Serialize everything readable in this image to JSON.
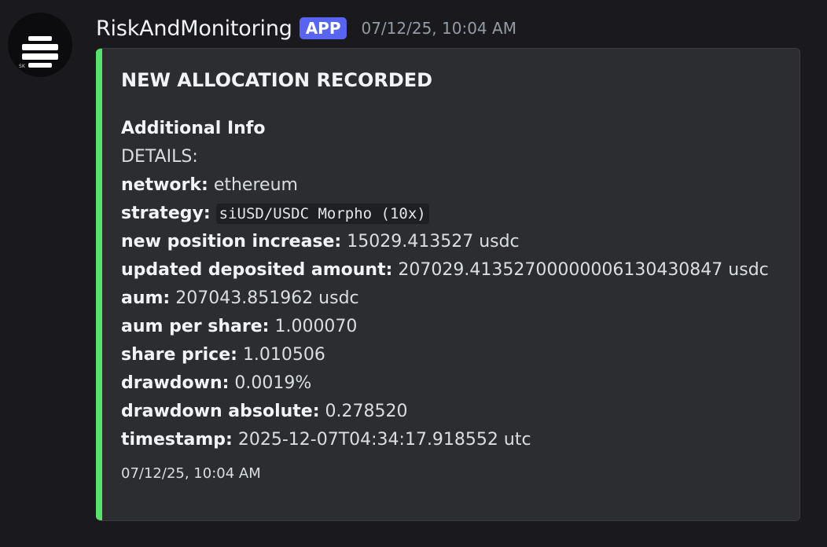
{
  "message": {
    "avatar_icon": "striped-globe-logo",
    "avatar_text": "SK",
    "username": "RiskAndMonitoring",
    "badge": "APP",
    "timestamp": "07/12/25, 10:04 AM"
  },
  "embed": {
    "accent_color": "#57e36a",
    "title": "NEW ALLOCATION RECORDED",
    "field_name": "Additional Info",
    "details_label": "DETAILS:",
    "lines": [
      {
        "key": "network:",
        "value": "ethereum"
      },
      {
        "key": "strategy:",
        "value": "siUSD/USDC Morpho (10x)"
      },
      {
        "key": "new position increase:",
        "value": "15029.413527 usdc"
      },
      {
        "key": "updated deposited amount:",
        "value": "207029.41352700000006130430847 usdc"
      },
      {
        "key": "aum:",
        "value": "207043.851962 usdc"
      },
      {
        "key": "aum per share:",
        "value": "1.000070"
      },
      {
        "key": "share price:",
        "value": "1.010506"
      },
      {
        "key": "drawdown:",
        "value": "0.0019%"
      },
      {
        "key": "drawdown absolute:",
        "value": "0.278520"
      },
      {
        "key": "timestamp:",
        "value": "2025-12-07T04:34:17.918552 utc"
      }
    ],
    "footer_timestamp": "07/12/25, 10:04 AM"
  }
}
